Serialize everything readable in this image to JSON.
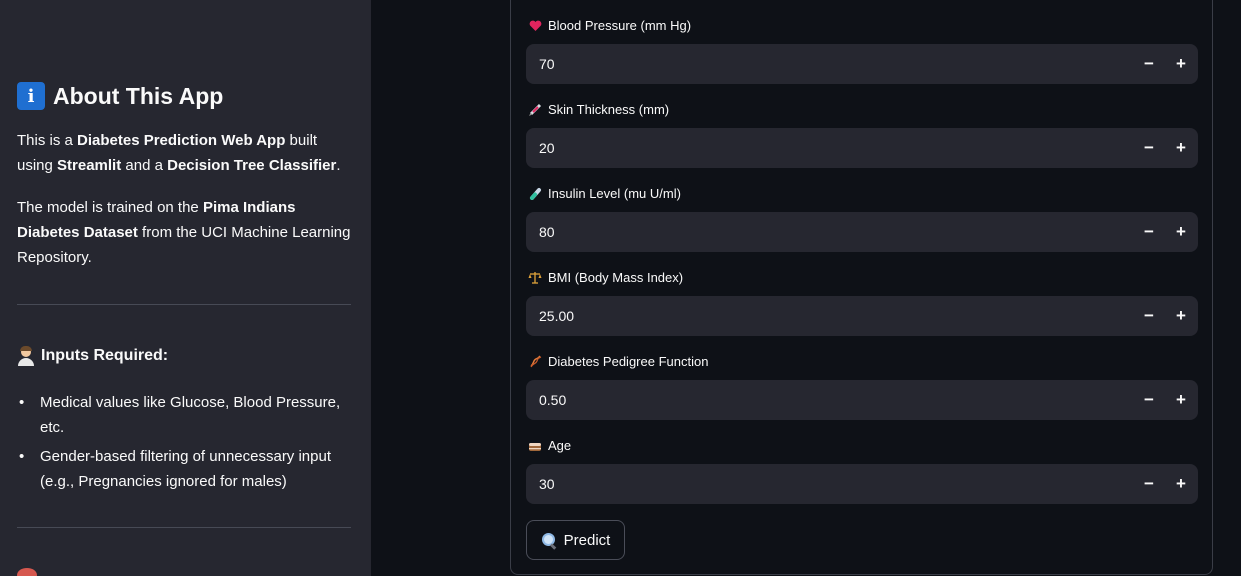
{
  "sidebar": {
    "about_title": "About This App",
    "about_icon": "info-icon",
    "para1": {
      "t1": "This is a ",
      "b1": "Diabetes Prediction Web App",
      "t2": " built using ",
      "b2": "Streamlit",
      "t3": " and a ",
      "b3": "Decision Tree Classifier",
      "t4": "."
    },
    "para2": {
      "t1": "The model is trained on the ",
      "b1": "Pima Indians Diabetes Dataset",
      "t2": " from the UCI Machine Learning Repository."
    },
    "inputs_title": "Inputs Required:",
    "inputs_icon": "health-worker-icon",
    "bullets": [
      "Medical values like Glucose, Blood Pressure, etc.",
      "Gender-based filtering of unnecessary input (e.g., Pregnancies ignored for males)"
    ]
  },
  "form": {
    "fields": [
      {
        "label": "Blood Pressure (mm Hg)",
        "icon": "heart-icon",
        "value": "70"
      },
      {
        "label": "Skin Thickness (mm)",
        "icon": "syringe-icon",
        "value": "20"
      },
      {
        "label": "Insulin Level (mu U/ml)",
        "icon": "test-tube-icon",
        "value": "80"
      },
      {
        "label": "BMI (Body Mass Index)",
        "icon": "balance-scale-icon",
        "value": "25.00"
      },
      {
        "label": "Diabetes Pedigree Function",
        "icon": "dna-icon",
        "value": "0.50"
      },
      {
        "label": "Age",
        "icon": "birthday-cake-icon",
        "value": "30"
      }
    ],
    "minus_label": "−",
    "plus_label": "+",
    "predict_label": "Predict",
    "predict_icon": "magnifier-icon"
  },
  "colors": {
    "background": "#0e1117",
    "sidebar": "#262730",
    "input_bg": "#262730",
    "text": "#fafafa"
  }
}
